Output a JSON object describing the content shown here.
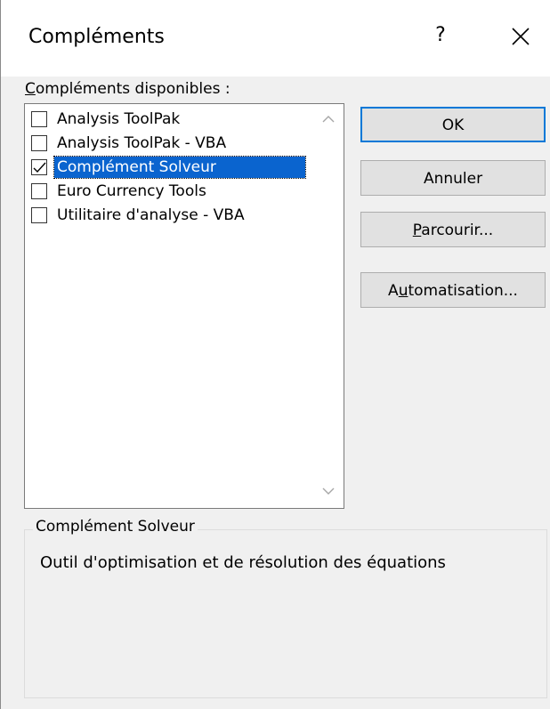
{
  "dialog": {
    "title": "Compléments",
    "help_label": "?",
    "close_label": "×"
  },
  "list": {
    "label_mnemonic": "C",
    "label_rest": "ompléments disponibles :",
    "items": [
      {
        "label": "Analysis ToolPak",
        "checked": false,
        "selected": false
      },
      {
        "label": "Analysis ToolPak - VBA",
        "checked": false,
        "selected": false
      },
      {
        "label": "Complément Solveur",
        "checked": true,
        "selected": true
      },
      {
        "label": "Euro Currency Tools",
        "checked": false,
        "selected": false
      },
      {
        "label": "Utilitaire d'analyse - VBA",
        "checked": false,
        "selected": false
      }
    ]
  },
  "buttons": {
    "ok": "OK",
    "cancel": "Annuler",
    "browse_mnemonic": "P",
    "browse_rest": "arcourir...",
    "automation_pre": "A",
    "automation_mnemonic": "u",
    "automation_rest": "tomatisation..."
  },
  "details": {
    "group_title": "Complément Solveur",
    "description": "Outil d'optimisation et de résolution des équations"
  },
  "colors": {
    "selection": "#0a64cf",
    "default_button_border": "#0078d7",
    "dialog_background": "#f0f0f0"
  }
}
